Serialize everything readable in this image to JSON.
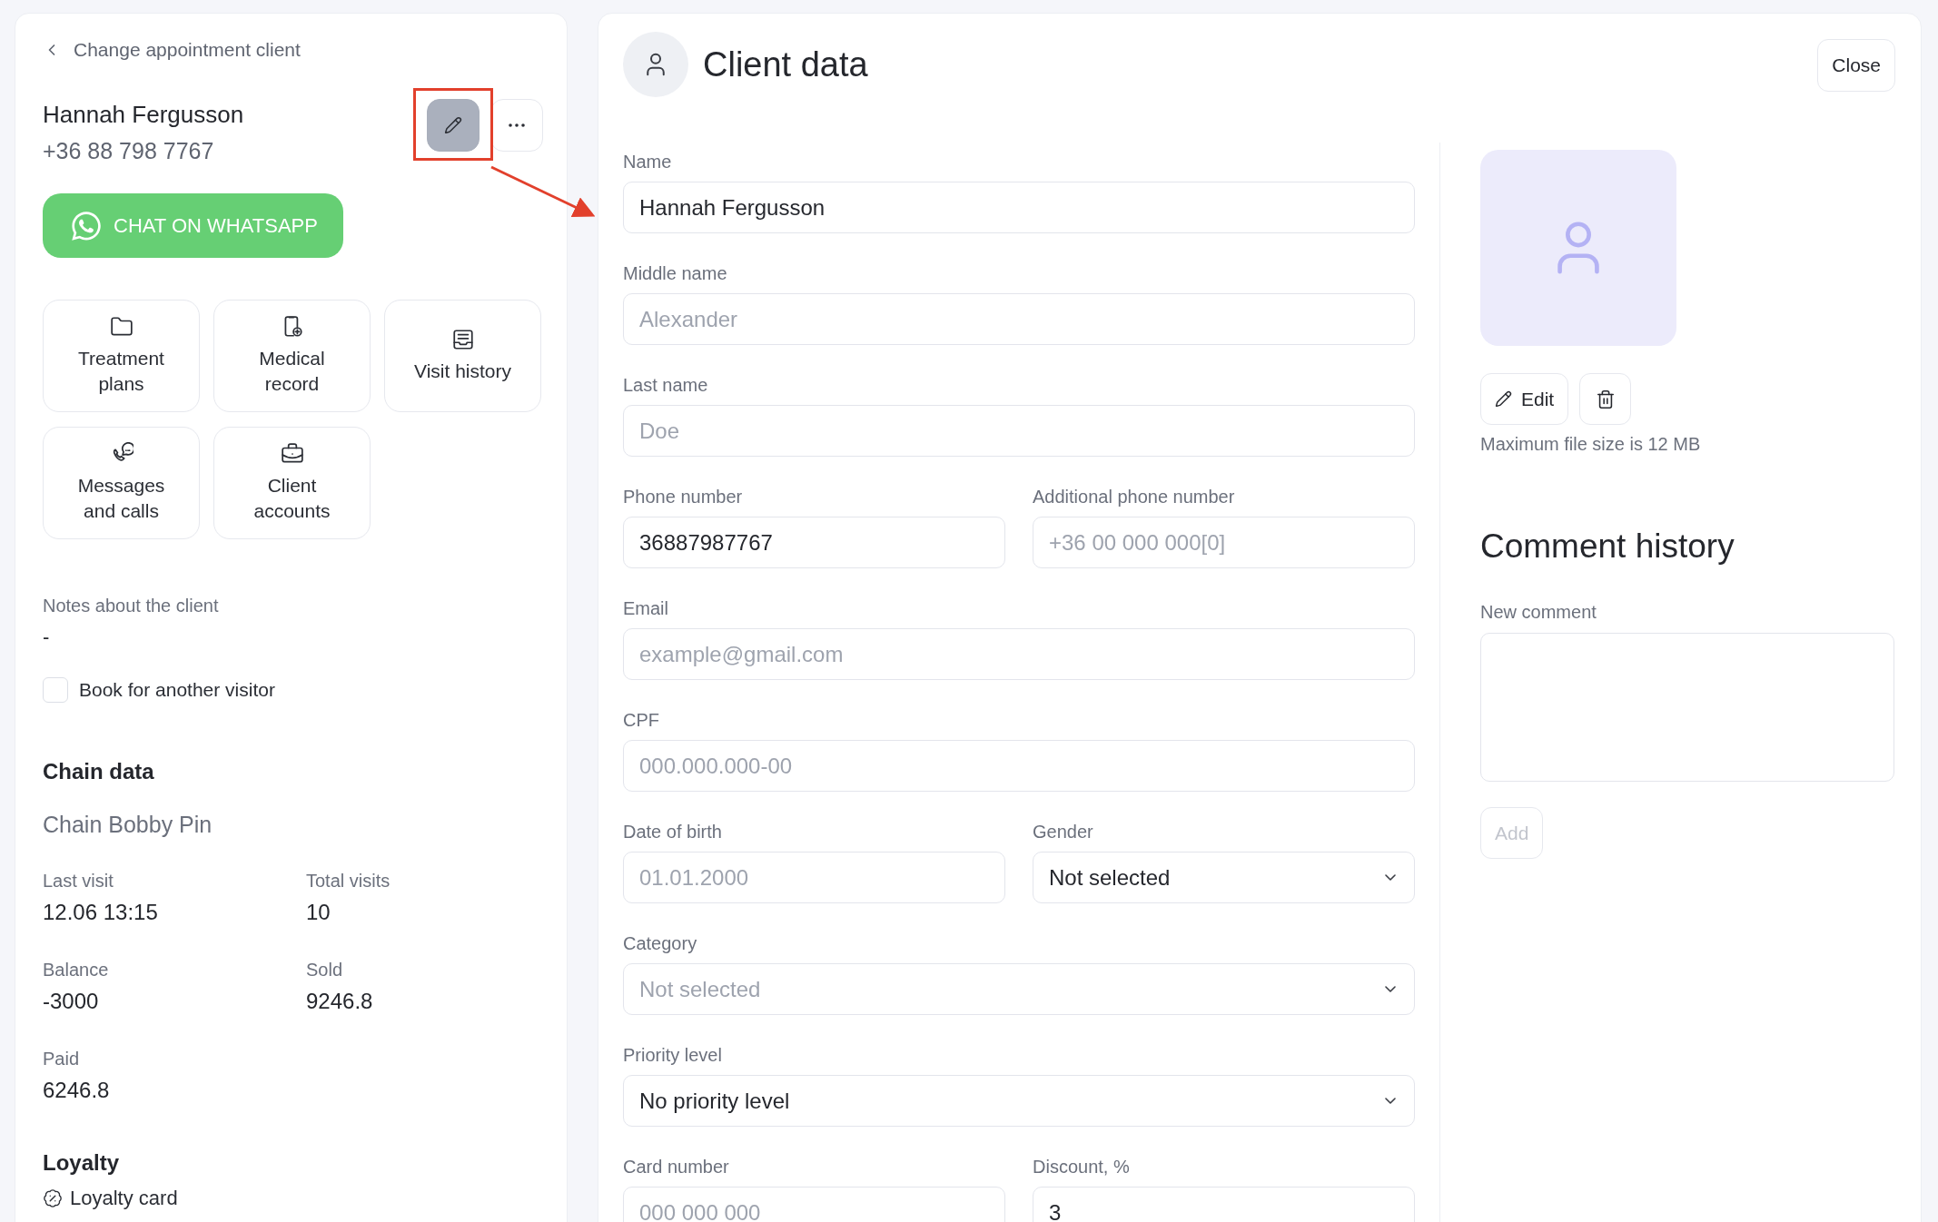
{
  "back_link": {
    "label": "Change appointment client"
  },
  "client": {
    "name": "Hannah Fergusson",
    "phone": "+36 88 798 7767",
    "edit_button": {
      "selected": true,
      "callout": true
    }
  },
  "whatsapp_button": {
    "label": "CHAT ON WHATSAPP"
  },
  "tiles": [
    {
      "kind": "folder",
      "label": "Treatment plans"
    },
    {
      "kind": "medical",
      "label": "Medical record"
    },
    {
      "kind": "history",
      "label": "Visit history"
    },
    {
      "kind": "messages",
      "label": "Messages and calls"
    },
    {
      "kind": "briefcase",
      "label": "Client accounts"
    }
  ],
  "notes": {
    "label": "Notes about the client",
    "value": "-"
  },
  "book_for_another": {
    "label": "Book for another visitor",
    "checked": false
  },
  "chain_data": {
    "title": "Chain data",
    "chain_name": "Chain Bobby Pin",
    "stats": [
      {
        "label": "Last visit",
        "value": "12.06 13:15"
      },
      {
        "label": "Total visits",
        "value": "10"
      },
      {
        "label": "Balance",
        "value": "-3000"
      },
      {
        "label": "Sold",
        "value": "9246.8"
      },
      {
        "label": "Paid",
        "value": "6246.8"
      }
    ]
  },
  "loyalty": {
    "title": "Loyalty",
    "item": "Loyalty card"
  },
  "dialog": {
    "title": "Client data",
    "close_button": "Close"
  },
  "form_rows": [
    [
      {
        "label": "Name",
        "kind": "text",
        "value": "Hannah Fergusson"
      }
    ],
    [
      {
        "label": "Middle name",
        "kind": "text",
        "placeholder": "Alexander"
      }
    ],
    [
      {
        "label": "Last name",
        "kind": "text",
        "placeholder": "Doe"
      }
    ],
    [
      {
        "label": "Phone number",
        "kind": "text",
        "value": "36887987767"
      },
      {
        "label": "Additional phone number",
        "kind": "text",
        "placeholder": "+36 00 000 000[0]"
      }
    ],
    [
      {
        "label": "Email",
        "kind": "text",
        "placeholder": "example@gmail.com"
      }
    ],
    [
      {
        "label": "CPF",
        "kind": "text",
        "placeholder": "000.000.000-00"
      }
    ],
    [
      {
        "label": "Date of birth",
        "kind": "text",
        "placeholder": "01.01.2000"
      },
      {
        "label": "Gender",
        "kind": "select",
        "value": "Not selected"
      }
    ],
    [
      {
        "label": "Category",
        "kind": "select",
        "placeholder": "Not selected"
      }
    ],
    [
      {
        "label": "Priority level",
        "kind": "select",
        "value": "No priority level"
      }
    ],
    [
      {
        "label": "Card number",
        "kind": "text",
        "placeholder": "000 000 000"
      },
      {
        "label": "Discount, %",
        "kind": "text",
        "value": "3"
      }
    ]
  ],
  "photo": {
    "edit_button": "Edit",
    "hint": "Maximum file size is 12 MB"
  },
  "comments": {
    "title": "Comment history",
    "field_label": "New comment",
    "add_button": {
      "label": "Add",
      "disabled": true
    }
  }
}
